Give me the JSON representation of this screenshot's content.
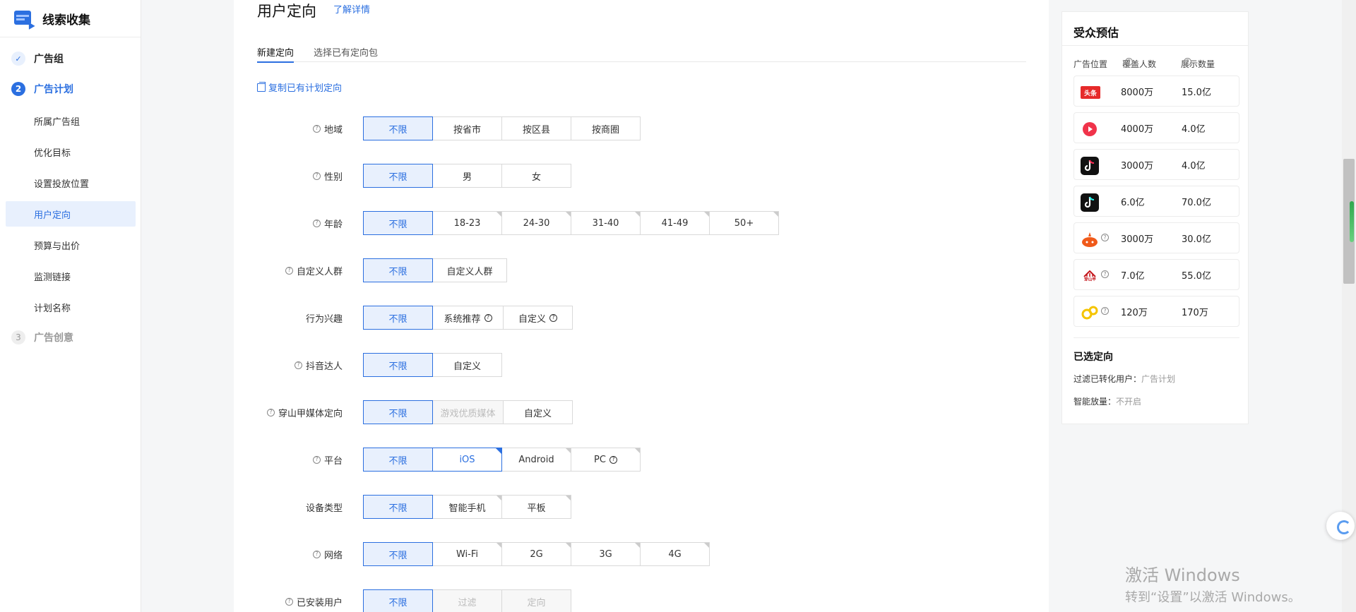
{
  "sidebar": {
    "brand_title": "线索收集",
    "steps": [
      {
        "num": "✓",
        "label": "广告组"
      },
      {
        "num": "2",
        "label": "广告计划"
      },
      {
        "num": "3",
        "label": "广告创意"
      }
    ],
    "sub_items": [
      "所属广告组",
      "优化目标",
      "设置投放位置",
      "用户定向",
      "预算与出价",
      "监测链接",
      "计划名称"
    ]
  },
  "main": {
    "page_title": "用户定向",
    "title_link": "了解详情",
    "tabs": [
      "新建定向",
      "选择已有定向包"
    ],
    "copy_link": "复制已有计划定向",
    "rows": [
      {
        "label": "地域",
        "options": [
          "不限",
          "按省市",
          "按区县",
          "按商圈"
        ]
      },
      {
        "label": "性别",
        "options": [
          "不限",
          "男",
          "女"
        ]
      },
      {
        "label": "年龄",
        "options": [
          "不限",
          "18-23",
          "24-30",
          "31-40",
          "41-49",
          "50+"
        ]
      },
      {
        "label": "自定义人群",
        "options": [
          "不限",
          "自定义人群"
        ]
      },
      {
        "label": "行为兴趣",
        "options": [
          "不限",
          "系统推荐",
          "自定义"
        ]
      },
      {
        "label": "抖音达人",
        "options": [
          "不限",
          "自定义"
        ]
      },
      {
        "label": "穿山甲媒体定向",
        "options": [
          "不限",
          "游戏优质媒体",
          "自定义"
        ]
      },
      {
        "label": "平台",
        "options": [
          "不限",
          "iOS",
          "Android",
          "PC"
        ]
      },
      {
        "label": "设备类型",
        "options": [
          "不限",
          "智能手机",
          "平板"
        ]
      },
      {
        "label": "网络",
        "options": [
          "不限",
          "Wi-Fi",
          "2G",
          "3G",
          "4G"
        ]
      },
      {
        "label": "已安装用户",
        "options": [
          "不限",
          "过滤",
          "定向"
        ]
      }
    ]
  },
  "audience": {
    "title": "受众预估",
    "headers": [
      "广告位置",
      "覆盖人数",
      "展示数量"
    ],
    "rows": [
      {
        "icon": "toutiao-icon",
        "coverage": "8000万",
        "impressions": "15.0亿"
      },
      {
        "icon": "xigua-icon",
        "coverage": "4000万",
        "impressions": "4.0亿"
      },
      {
        "icon": "douyin-icon",
        "coverage": "3000万",
        "impressions": "4.0亿"
      },
      {
        "icon": "douyin-lite-icon",
        "coverage": "6.0亿",
        "impressions": "70.0亿"
      },
      {
        "icon": "huoshan-icon",
        "coverage": "3000万",
        "impressions": "30.0亿"
      },
      {
        "icon": "pangle-icon",
        "coverage": "7.0亿",
        "impressions": "55.0亿"
      },
      {
        "icon": "yellow-app-icon",
        "coverage": "120万",
        "impressions": "170万"
      }
    ],
    "selected_title": "已选定向",
    "selected": [
      {
        "key": "过滤已转化用户：",
        "value": "广告计划"
      },
      {
        "key": "智能放量：",
        "value": "不开启"
      }
    ],
    "icon_texts": {
      "toutiao": "头条",
      "pangle": "穿山甲"
    }
  },
  "watermark": {
    "line1": "激活 Windows",
    "line2": "转到“设置”以激活 Windows。"
  },
  "colors": {
    "accent": "#2b6fe0",
    "selected_bg": "#e8f0fd"
  }
}
